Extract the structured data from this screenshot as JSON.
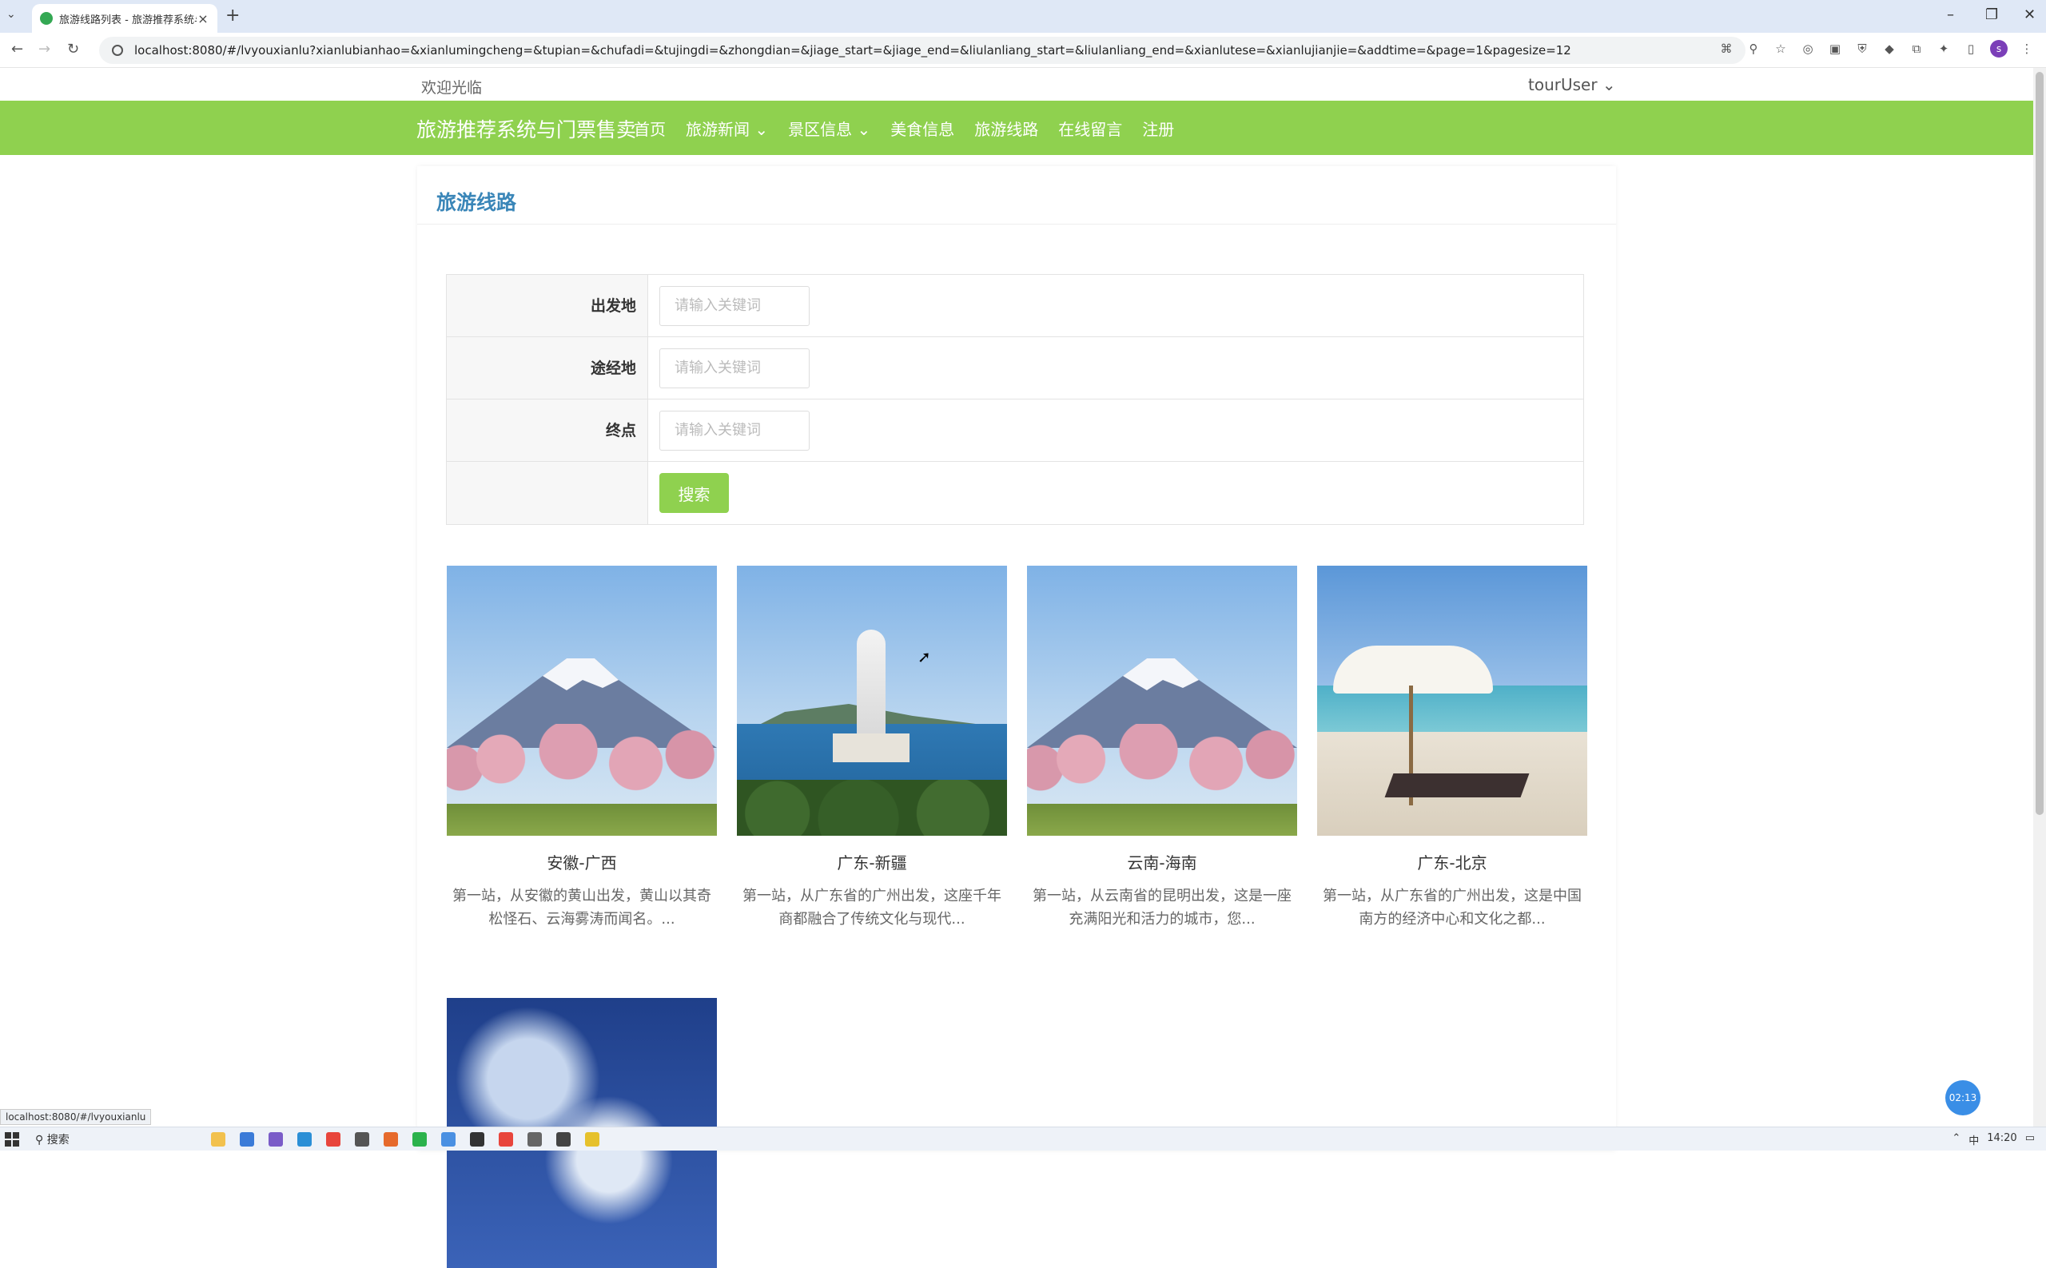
{
  "browser": {
    "tab_title": "旅游线路列表 - 旅游推荐系统与",
    "url": "localhost:8080/#/lvyouxianlu?xianlubianhao=&xianlumingcheng=&tupian=&chufadi=&tujingdi=&zhongdian=&jiage_start=&jiage_end=&liulanliang_start=&liulanliang_end=&xianlutese=&xianlujianjie=&addtime=&page=1&pagesize=12",
    "status_url": "localhost:8080/#/lvyouxianlu"
  },
  "header": {
    "welcome": "欢迎光临",
    "user": "tourUser",
    "logo": "旅游推荐系统与门票售卖",
    "menu": [
      "首页",
      "旅游新闻",
      "景区信息",
      "美食信息",
      "旅游线路",
      "在线留言",
      "注册"
    ]
  },
  "page": {
    "title": "旅游线路",
    "search": {
      "label_from": "出发地",
      "label_via": "途经地",
      "label_to": "终点",
      "placeholder": "请输入关键词",
      "button": "搜索"
    },
    "cards": [
      {
        "name": "安徽-广西",
        "desc": "第一站，从安徽的黄山出发，黄山以其奇松怪石、云海雾涛而闻名。..."
      },
      {
        "name": "广东-新疆",
        "desc": "第一站，从广东省的广州出发，这座千年商都融合了传统文化与现代..."
      },
      {
        "name": "云南-海南",
        "desc": "第一站，从云南省的昆明出发，这是一座充满阳光和活力的城市，您..."
      },
      {
        "name": "广东-北京",
        "desc": "第一站，从广东省的广州出发，这是中国南方的经济中心和文化之都..."
      }
    ]
  },
  "overlay": {
    "timer": "02:13"
  },
  "taskbar": {
    "search": "搜索",
    "time": "14:20",
    "ime": "中"
  }
}
